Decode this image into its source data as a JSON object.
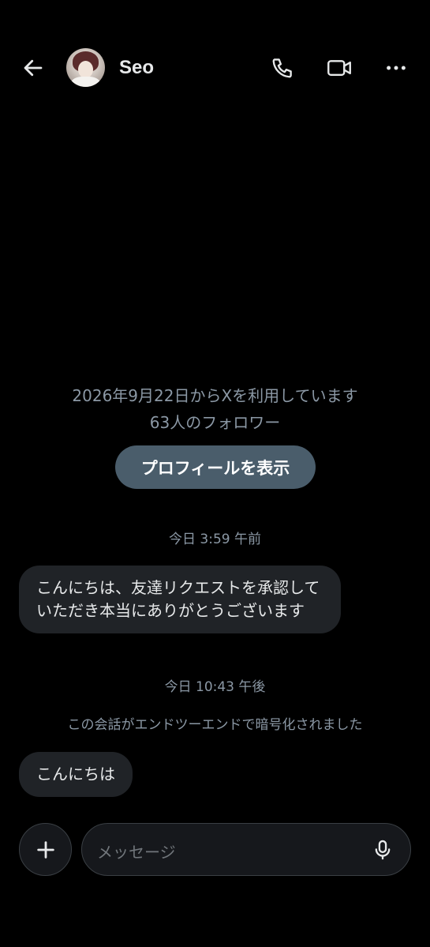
{
  "header": {
    "back_icon": "arrow-left-icon",
    "contact_name": "Seo",
    "phone_icon": "phone-icon",
    "video_icon": "video-camera-icon",
    "more_icon": "more-horizontal-icon"
  },
  "profile_info": {
    "joined": "2026年9月22日からXを利用しています",
    "followers": "63人のフォロワー",
    "view_profile_label": "プロフィールを表示"
  },
  "conversation": [
    {
      "type": "timestamp",
      "text": "今日 3:59 午前"
    },
    {
      "type": "message",
      "text": "こんにちは、友達リクエストを承認していただき本当にありがとうございます"
    },
    {
      "type": "timestamp",
      "text": "今日 10:43 午後"
    },
    {
      "type": "notice",
      "text": "この会話がエンドツーエンドで暗号化されました"
    },
    {
      "type": "message",
      "text": "こんにちは"
    }
  ],
  "composer": {
    "placeholder": "メッセージ",
    "add_icon": "plus-icon",
    "mic_icon": "microphone-icon"
  },
  "colors": {
    "background": "#000000",
    "bubble": "#202327",
    "profile_button": "#4a5d6b",
    "muted_text": "#8b98a5"
  }
}
